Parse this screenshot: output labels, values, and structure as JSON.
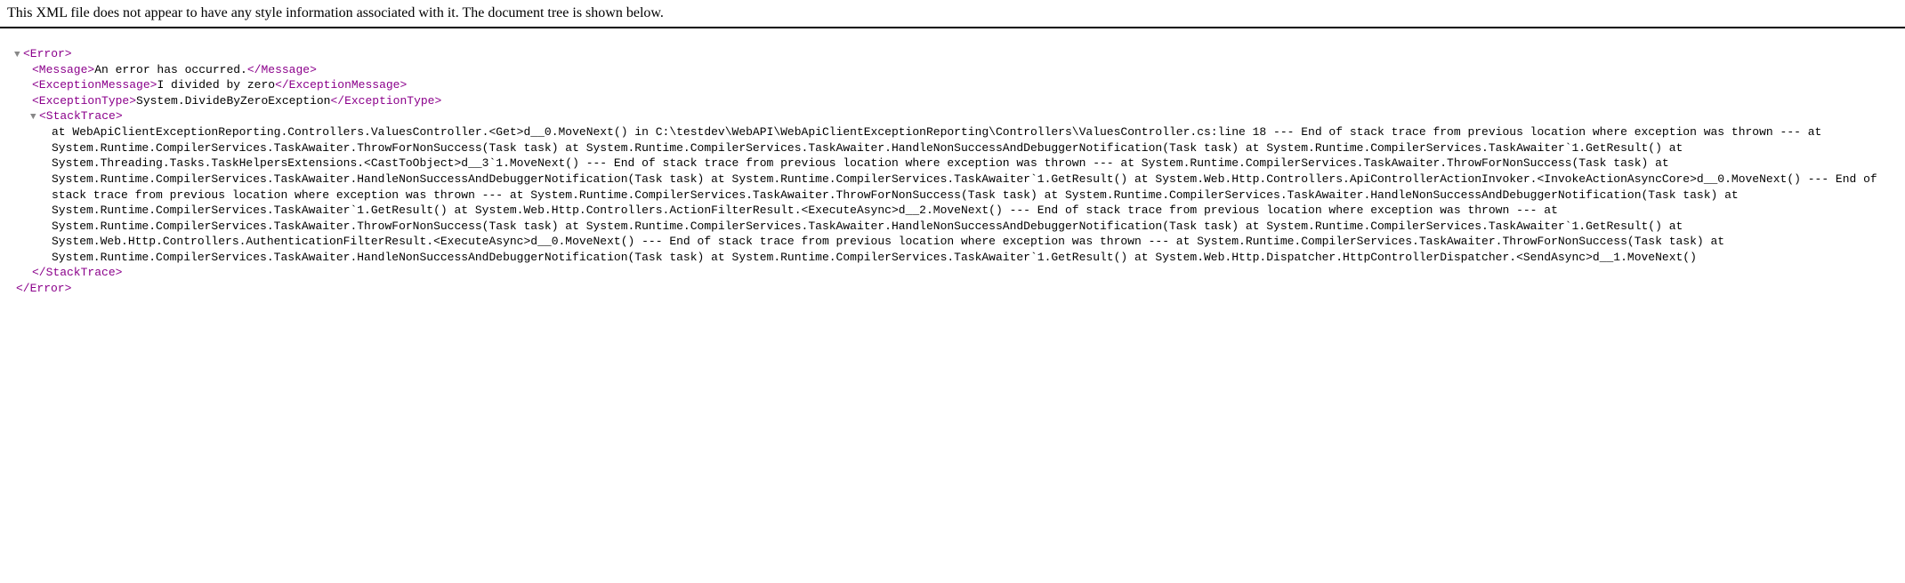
{
  "header": {
    "text": "This XML file does not appear to have any style information associated with it. The document tree is shown below."
  },
  "xml": {
    "root_open": "<Error>",
    "root_close": "</Error>",
    "message": {
      "open": "<Message>",
      "text": "An error has occurred.",
      "close": "</Message>"
    },
    "exceptionMessage": {
      "open": "<ExceptionMessage>",
      "text": "I divided by zero",
      "close": "</ExceptionMessage>"
    },
    "exceptionType": {
      "open": "<ExceptionType>",
      "text": "System.DivideByZeroException",
      "close": "</ExceptionType>"
    },
    "stackTrace": {
      "open": "<StackTrace>",
      "close": "</StackTrace>",
      "text": "at WebApiClientExceptionReporting.Controllers.ValuesController.<Get>d__0.MoveNext() in C:\\testdev\\WebAPI\\WebApiClientExceptionReporting\\Controllers\\ValuesController.cs:line 18 --- End of stack trace from previous location where exception was thrown --- at System.Runtime.CompilerServices.TaskAwaiter.ThrowForNonSuccess(Task task) at System.Runtime.CompilerServices.TaskAwaiter.HandleNonSuccessAndDebuggerNotification(Task task) at System.Runtime.CompilerServices.TaskAwaiter`1.GetResult() at System.Threading.Tasks.TaskHelpersExtensions.<CastToObject>d__3`1.MoveNext() --- End of stack trace from previous location where exception was thrown --- at System.Runtime.CompilerServices.TaskAwaiter.ThrowForNonSuccess(Task task) at System.Runtime.CompilerServices.TaskAwaiter.HandleNonSuccessAndDebuggerNotification(Task task) at System.Runtime.CompilerServices.TaskAwaiter`1.GetResult() at System.Web.Http.Controllers.ApiControllerActionInvoker.<InvokeActionAsyncCore>d__0.MoveNext() --- End of stack trace from previous location where exception was thrown --- at System.Runtime.CompilerServices.TaskAwaiter.ThrowForNonSuccess(Task task) at System.Runtime.CompilerServices.TaskAwaiter.HandleNonSuccessAndDebuggerNotification(Task task) at System.Runtime.CompilerServices.TaskAwaiter`1.GetResult() at System.Web.Http.Controllers.ActionFilterResult.<ExecuteAsync>d__2.MoveNext() --- End of stack trace from previous location where exception was thrown --- at System.Runtime.CompilerServices.TaskAwaiter.ThrowForNonSuccess(Task task) at System.Runtime.CompilerServices.TaskAwaiter.HandleNonSuccessAndDebuggerNotification(Task task) at System.Runtime.CompilerServices.TaskAwaiter`1.GetResult() at System.Web.Http.Controllers.AuthenticationFilterResult.<ExecuteAsync>d__0.MoveNext() --- End of stack trace from previous location where exception was thrown --- at System.Runtime.CompilerServices.TaskAwaiter.ThrowForNonSuccess(Task task) at System.Runtime.CompilerServices.TaskAwaiter.HandleNonSuccessAndDebuggerNotification(Task task) at System.Runtime.CompilerServices.TaskAwaiter`1.GetResult() at System.Web.Http.Dispatcher.HttpControllerDispatcher.<SendAsync>d__1.MoveNext()"
    }
  }
}
